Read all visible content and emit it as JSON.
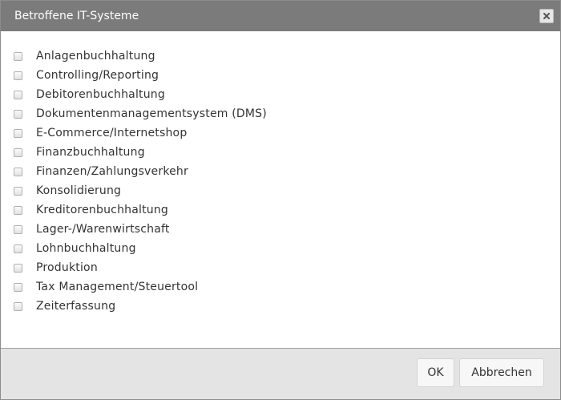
{
  "dialog": {
    "title": "Betroffene IT-Systeme",
    "close_icon": "close-icon"
  },
  "items": [
    {
      "label": "Anlagenbuchhaltung",
      "checked": false
    },
    {
      "label": "Controlling/Reporting",
      "checked": false
    },
    {
      "label": "Debitorenbuchhaltung",
      "checked": false
    },
    {
      "label": "Dokumentenmanagementsystem (DMS)",
      "checked": false
    },
    {
      "label": "E-Commerce/Internetshop",
      "checked": false
    },
    {
      "label": "Finanzbuchhaltung",
      "checked": false
    },
    {
      "label": "Finanzen/Zahlungsverkehr",
      "checked": false
    },
    {
      "label": "Konsolidierung",
      "checked": false
    },
    {
      "label": "Kreditorenbuchhaltung",
      "checked": false
    },
    {
      "label": "Lager-/Warenwirtschaft",
      "checked": false
    },
    {
      "label": "Lohnbuchhaltung",
      "checked": false
    },
    {
      "label": "Produktion",
      "checked": false
    },
    {
      "label": "Tax Management/Steuertool",
      "checked": false
    },
    {
      "label": "Zeiterfassung",
      "checked": false
    }
  ],
  "footer": {
    "ok_label": "OK",
    "cancel_label": "Abbrechen"
  },
  "colors": {
    "titlebar": "#7b7b7b",
    "footer": "#e4e4e4",
    "text": "#333333"
  }
}
